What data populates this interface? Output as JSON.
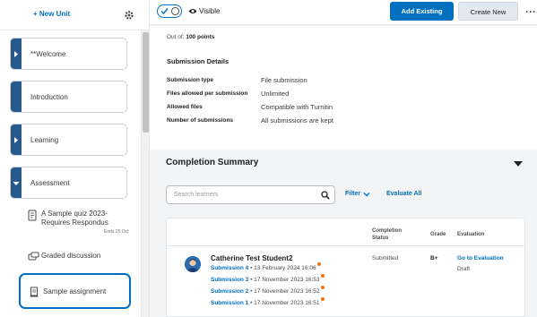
{
  "sidebar": {
    "new_unit_label": "+ New Unit",
    "units": [
      {
        "label": "**Welcome",
        "expanded": false
      },
      {
        "label": "Introduction",
        "expanded": false
      },
      {
        "label": "Learning",
        "expanded": false
      },
      {
        "label": "Assessment",
        "expanded": true
      }
    ],
    "sub_items": [
      {
        "label": "A Sample quiz 2023- Requires Respondus",
        "meta": "Ends 25 Oct",
        "icon": "quiz-icon"
      },
      {
        "label": "Graded discussion",
        "icon": "discussion-icon"
      },
      {
        "label": "Sample assignment",
        "icon": "assignment-icon",
        "selected": true
      }
    ]
  },
  "topbar": {
    "visibility_label": "Visible",
    "add_existing_label": "Add Existing",
    "create_new_label": "Create New",
    "more_label": "···"
  },
  "details": {
    "out_of_prefix": "Out of:",
    "out_of_value": "100 points",
    "section_title": "Submission Details",
    "rows": [
      {
        "label": "Submission type",
        "value": "File submission"
      },
      {
        "label": "Files allowed per submission",
        "value": "Unlimited"
      },
      {
        "label": "Allowed files",
        "value": "Compatible with Turnitin"
      },
      {
        "label": "Number of submissions",
        "value": "All submissions are kept"
      }
    ]
  },
  "completion": {
    "title": "Completion Summary",
    "search_placeholder": "Search learners",
    "filter_label": "Filter",
    "evaluate_all_label": "Evaluate All",
    "columns": {
      "status": "Completion Status",
      "grade": "Grade",
      "evaluation": "Evaluation"
    },
    "student": {
      "name": "Catherine Test Student2",
      "status": "Submitted",
      "grade": "B+",
      "eval_link": "Go to Evaluation",
      "eval_state": "Draft",
      "submissions": [
        {
          "label": "Submission 4",
          "date": "13 February 2024 16:06"
        },
        {
          "label": "Submission 3",
          "date": "17 November 2023 16:53"
        },
        {
          "label": "Submission 2",
          "date": "17 November 2023 16:52"
        },
        {
          "label": "Submission 1",
          "date": "17 November 2023 16:51"
        }
      ]
    }
  },
  "colors": {
    "accent": "#006fbf",
    "unit_bar": "#29598a",
    "new_dot": "#e87511"
  }
}
